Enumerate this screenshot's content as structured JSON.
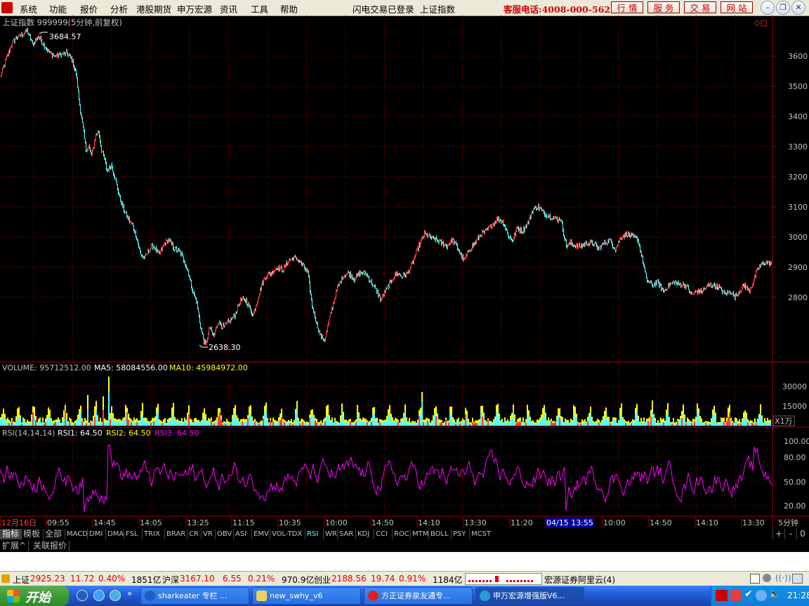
{
  "menu": {
    "items": [
      "系统",
      "功能",
      "报价",
      "分析",
      "港股期货",
      "申万宏源",
      "资讯",
      "工具",
      "帮助"
    ],
    "login_status": "闪电交易已登录",
    "current_symbol": "上证指数",
    "hotline": "客服电话:4008-000-562",
    "right_buttons": [
      "行 情",
      "服 务",
      "交 易",
      "网 站"
    ]
  },
  "header": {
    "title": "上证指数 999999(5分钟,前复权)",
    "max_label": "3684.57",
    "min_label": "2638.30"
  },
  "volume": {
    "label": "VOLUME: 95712512.00",
    "ma5": "MA5: 58084556.00",
    "ma10": "MA10: 45984972.00",
    "ticks": [
      "30000",
      "15000"
    ],
    "unit": "X1万"
  },
  "rsi": {
    "label": "RSI(14,14,14)",
    "rsi1": "RSI1: 64.50",
    "rsi2": "RSI2: 64.50",
    "rsi3": "RSI3: 64.50",
    "ticks": [
      "100.00",
      "80.00",
      "50.00",
      "20.00"
    ]
  },
  "time_axis": {
    "labels": [
      "12月16日",
      "09:55",
      "14:45",
      "14:05",
      "13:25",
      "11:15",
      "10:35",
      "10:00",
      "14:50",
      "14:10",
      "13:30",
      "11:20",
      "04/15 13:55",
      "10:00",
      "14:50",
      "14:10",
      "13:30"
    ],
    "period": "5分钟"
  },
  "indicator_tabs": [
    "指标",
    "模板",
    "全部",
    "MACD",
    "DMI",
    "DMA",
    "FSL",
    "TRIX",
    "BRAR",
    "CR",
    "VR",
    "OBV",
    "ASI",
    "EMV",
    "VOL-TDX",
    "RSI",
    "WR",
    "SAR",
    "KDJ",
    "CCI",
    "ROC",
    "MTM",
    "BOLL",
    "PSY",
    "MCST"
  ],
  "scroll_controls": [
    "+",
    "-",
    "0"
  ],
  "bottom_tabs": [
    "扩展^",
    "关联报价"
  ],
  "status_bar": {
    "sh_name": "上证",
    "sh_price": "2925.23",
    "sh_change": "11.72",
    "sh_pct": "0.40%",
    "sh_amount": "1851亿",
    "hs_name": "沪深",
    "hs_price": "3167.10",
    "hs_change": "6.55",
    "hs_pct": "0.21%",
    "hs_amount": "970.9亿",
    "cy_name": "创业",
    "cy_price": "2188.56",
    "cy_change": "19.74",
    "cy_pct": "0.91%",
    "cy_amount": "1184亿",
    "server": "宏源证券阿里云(4)"
  },
  "taskbar": {
    "start": "开始",
    "tasks": [
      "sharkeater 专栏 ...",
      "new_swhy_v6",
      "方正证券泉友通专...",
      "申万宏源增强版V6..."
    ],
    "clock": "21:28"
  },
  "colors": {
    "up": "#ff3c3c",
    "down": "#54ffff",
    "grid": "#800000",
    "rsi": "#ff00ff",
    "ma5": "#ffffff",
    "ma10": "#ffff00"
  },
  "chart_data": {
    "type": "line",
    "title": "上证指数 999999(5分钟,前复权)",
    "ylim": [
      2600,
      3700
    ],
    "yticks": [
      2800,
      2900,
      3000,
      3100,
      3200,
      3300,
      3400,
      3500,
      3600
    ],
    "price_keypoints": [
      [
        0,
        3530
      ],
      [
        4,
        3560
      ],
      [
        10,
        3600
      ],
      [
        16,
        3640
      ],
      [
        22,
        3660
      ],
      [
        30,
        3670
      ],
      [
        38,
        3684.57
      ],
      [
        46,
        3640
      ],
      [
        54,
        3665
      ],
      [
        62,
        3640
      ],
      [
        70,
        3610
      ],
      [
        78,
        3600
      ],
      [
        86,
        3605
      ],
      [
        94,
        3610
      ],
      [
        102,
        3590
      ],
      [
        108,
        3540
      ],
      [
        114,
        3420
      ],
      [
        118,
        3360
      ],
      [
        122,
        3290
      ],
      [
        126,
        3300
      ],
      [
        130,
        3270
      ],
      [
        136,
        3340
      ],
      [
        140,
        3350
      ],
      [
        144,
        3290
      ],
      [
        148,
        3260
      ],
      [
        152,
        3220
      ],
      [
        158,
        3240
      ],
      [
        164,
        3190
      ],
      [
        170,
        3130
      ],
      [
        176,
        3090
      ],
      [
        182,
        3060
      ],
      [
        188,
        3040
      ],
      [
        194,
        3000
      ],
      [
        200,
        2940
      ],
      [
        206,
        2930
      ],
      [
        212,
        2960
      ],
      [
        218,
        2970
      ],
      [
        226,
        2940
      ],
      [
        234,
        2980
      ],
      [
        240,
        2990
      ],
      [
        248,
        2960
      ],
      [
        256,
        2950
      ],
      [
        262,
        2920
      ],
      [
        268,
        2880
      ],
      [
        274,
        2820
      ],
      [
        280,
        2780
      ],
      [
        286,
        2690
      ],
      [
        292,
        2638.3
      ],
      [
        298,
        2700
      ],
      [
        304,
        2670
      ],
      [
        310,
        2720
      ],
      [
        318,
        2700
      ],
      [
        326,
        2720
      ],
      [
        334,
        2740
      ],
      [
        342,
        2790
      ],
      [
        350,
        2790
      ],
      [
        356,
        2760
      ],
      [
        360,
        2740
      ],
      [
        366,
        2790
      ],
      [
        372,
        2840
      ],
      [
        378,
        2870
      ],
      [
        386,
        2880
      ],
      [
        394,
        2900
      ],
      [
        402,
        2890
      ],
      [
        410,
        2920
      ],
      [
        418,
        2930
      ],
      [
        426,
        2920
      ],
      [
        432,
        2900
      ],
      [
        438,
        2880
      ],
      [
        444,
        2770
      ],
      [
        450,
        2720
      ],
      [
        456,
        2670
      ],
      [
        462,
        2660
      ],
      [
        468,
        2720
      ],
      [
        474,
        2780
      ],
      [
        480,
        2830
      ],
      [
        488,
        2870
      ],
      [
        496,
        2880
      ],
      [
        504,
        2860
      ],
      [
        512,
        2880
      ],
      [
        520,
        2880
      ],
      [
        528,
        2850
      ],
      [
        536,
        2820
      ],
      [
        542,
        2790
      ],
      [
        548,
        2820
      ],
      [
        556,
        2850
      ],
      [
        564,
        2880
      ],
      [
        572,
        2870
      ],
      [
        580,
        2880
      ],
      [
        588,
        2920
      ],
      [
        596,
        2970
      ],
      [
        604,
        3010
      ],
      [
        612,
        3000
      ],
      [
        620,
        2990
      ],
      [
        628,
        2980
      ],
      [
        636,
        2970
      ],
      [
        644,
        2990
      ],
      [
        652,
        2960
      ],
      [
        660,
        2920
      ],
      [
        668,
        2960
      ],
      [
        676,
        2980
      ],
      [
        684,
        3010
      ],
      [
        692,
        3020
      ],
      [
        700,
        3040
      ],
      [
        708,
        3060
      ],
      [
        716,
        3050
      ],
      [
        724,
        3000
      ],
      [
        730,
        2990
      ],
      [
        736,
        3030
      ],
      [
        744,
        3020
      ],
      [
        752,
        3050
      ],
      [
        758,
        3090
      ],
      [
        766,
        3100
      ],
      [
        774,
        3080
      ],
      [
        782,
        3070
      ],
      [
        790,
        3060
      ],
      [
        798,
        3060
      ],
      [
        806,
        2970
      ],
      [
        812,
        2980
      ],
      [
        820,
        2970
      ],
      [
        828,
        2970
      ],
      [
        836,
        2980
      ],
      [
        844,
        2980
      ],
      [
        852,
        2960
      ],
      [
        860,
        2980
      ],
      [
        868,
        2990
      ],
      [
        876,
        2960
      ],
      [
        884,
        3000
      ],
      [
        892,
        3010
      ],
      [
        900,
        3000
      ],
      [
        908,
        2990
      ],
      [
        914,
        2930
      ],
      [
        920,
        2860
      ],
      [
        928,
        2840
      ],
      [
        936,
        2850
      ],
      [
        944,
        2820
      ],
      [
        952,
        2840
      ],
      [
        960,
        2850
      ],
      [
        968,
        2840
      ],
      [
        976,
        2840
      ],
      [
        984,
        2810
      ],
      [
        992,
        2820
      ],
      [
        1000,
        2820
      ],
      [
        1008,
        2840
      ],
      [
        1016,
        2840
      ],
      [
        1024,
        2830
      ],
      [
        1032,
        2810
      ],
      [
        1040,
        2820
      ],
      [
        1046,
        2800
      ],
      [
        1052,
        2820
      ],
      [
        1060,
        2840
      ],
      [
        1066,
        2820
      ],
      [
        1072,
        2850
      ],
      [
        1078,
        2890
      ],
      [
        1084,
        2910
      ],
      [
        1090,
        2915
      ],
      [
        1098,
        2910
      ]
    ]
  }
}
